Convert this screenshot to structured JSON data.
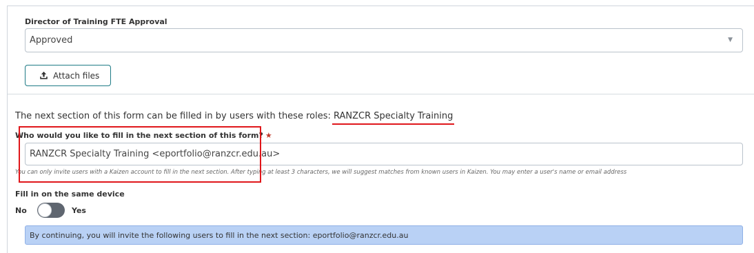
{
  "approval": {
    "label": "Director of Training FTE Approval",
    "selected_value": "Approved",
    "caret_icon": "chevron-down-icon"
  },
  "attach": {
    "label": "Attach files",
    "icon": "upload-icon"
  },
  "roles": {
    "prefix": "The next section of this form can be filled in by users with these roles: ",
    "role_name": "RANZCR Specialty Training"
  },
  "invite": {
    "label": "Who would you like to fill in the next section of this form?",
    "required_mark": "★",
    "value": "RANZCR Specialty Training <eportfolio@ranzcr.edu.au>",
    "hint": "You can only invite users with a Kaizen account to fill in the next section. After typing at least 3 characters, we will suggest matches from known users in Kaizen. You may enter a user's name or email address"
  },
  "same_device": {
    "label": "Fill in on the same device",
    "no_label": "No",
    "yes_label": "Yes",
    "is_on": false
  },
  "info_message": "By continuing, you will invite the following users to fill in the next section: eportfolio@ranzcr.edu.au",
  "colors": {
    "accent": "#1d7a85",
    "highlight": "#e0161a",
    "info_bg": "#b9d1f5"
  }
}
